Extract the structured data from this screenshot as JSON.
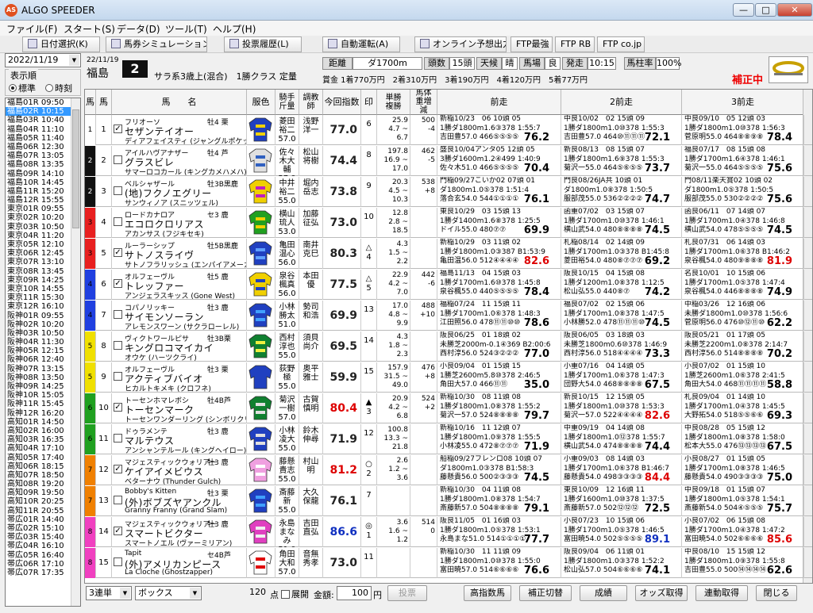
{
  "app": {
    "title": "ALGO SPEEDER",
    "icon": "AS"
  },
  "menu": [
    "ファイル(F)",
    "スタート(S)",
    "データ(D)",
    "ツール(T)",
    "ヘルプ(H)"
  ],
  "toolbar": [
    "日付選択(K)",
    "馬券シミュレーション(B)",
    "投票履歴(L)",
    "自動運転(A)",
    "オンライン予想出力",
    "FTP最強",
    "FTP RB",
    "FTP co.jp"
  ],
  "left": {
    "date": "2022/11/19",
    "order_label": "表示順",
    "radio_std": "標準",
    "radio_time": "時刻",
    "races": [
      "福島01R 09:50",
      "福島02R 10:15",
      "福島03R 10:40",
      "福島04R 11:10",
      "福島05R 11:40",
      "福島06R 12:30",
      "福島07R 13:05",
      "福島08R 13:35",
      "福島09R 14:10",
      "福島10R 14:45",
      "福島11R 15:20",
      "福島12R 15:55",
      "東京01R 09:55",
      "東京02R 10:20",
      "東京03R 10:50",
      "東京04R 11:20",
      "東京05R 12:10",
      "東京06R 12:45",
      "東京07R 13:10",
      "東京08R 13:45",
      "東京09R 14:25",
      "東京10R 14:55",
      "東京11R 15:30",
      "東京12R 16:10",
      "阪神01R 09:55",
      "阪神02R 10:20",
      "阪神03R 10:50",
      "阪神04R 11:30",
      "阪神05R 12:15",
      "阪神06R 12:40",
      "阪神07R 13:15",
      "阪神08R 13:50",
      "阪神09R 14:25",
      "阪神10R 15:05",
      "阪神11R 15:45",
      "阪神12R 16:20",
      "高知01R 14:50",
      "高知02R 16:00",
      "高知03R 16:35",
      "高知04R 17:10",
      "高知05R 17:40",
      "高知06R 18:15",
      "高知07R 18:50",
      "高知08R 19:20",
      "高知09R 19:50",
      "高知10R 20:25",
      "高知11R 20:55",
      "帯広01R 14:40",
      "帯広02R 15:10",
      "帯広03R 15:40",
      "帯広04R 16:10",
      "帯広05R 16:40",
      "帯広06R 17:10",
      "帯広07R 17:35"
    ],
    "selected": 1
  },
  "race": {
    "date": "22/11/19",
    "venue": "福島",
    "no": "2",
    "class": "サラ系3歳上(混合)　1勝クラス 定量",
    "lbl_dist": "距離",
    "dist": "ダ1700m",
    "lbl_heads": "頭数",
    "heads": "15頭",
    "lbl_weather": "天候",
    "weather": "晴",
    "lbl_track": "馬場",
    "track": "良",
    "lbl_start": "発走",
    "start": "10:15",
    "lbl_umabashira": "馬柱率",
    "umabashira": "100%",
    "prizes": "賞金 1着770万円　2着310万円　3着190万円　4着120万円　5着77万円",
    "status": "補正中"
  },
  "headers": {
    "waku": "馬",
    "uma": "馬",
    "name": "馬　　名",
    "silk": "服色",
    "jockey": "騎手斤量",
    "trainer": "調教師",
    "index": "今回指数",
    "mark": "印",
    "odds": "単勝複勝",
    "weight": "馬体重増減",
    "prev1": "前走",
    "prev2": "2前走",
    "prev3": "3前走"
  },
  "horses": [
    {
      "waku": "1",
      "uma": "1",
      "chk": true,
      "sire": "フリオーソ",
      "name": "セザンテイオー",
      "dam": "ディアフェイスティ (ジャングルポケット)",
      "sa": "牡4 栗",
      "jockey": "菱田裕二",
      "kg": "57.0",
      "trainer": "浅野洋一",
      "index": "77.0",
      "ic": "",
      "mark": "",
      "rank": "6",
      "o1": "25.9",
      "o2": "4.7 ~ 6.7",
      "w": "500",
      "wd": "-4",
      "p1": [
        "新稲10/23　06 10頭 05",
        "1勝ダ1800m1.6③378 1:55:7",
        "吉田豊57.0 466⑤⑤⑤⑤",
        "76.2"
      ],
      "p2": [
        "中良10/02　02 15頭 09",
        "1勝ダ1800m1.0⑩378 1:55:3",
        "吉田豊57.0 464⑩⑪⑪⑪",
        "72.1"
      ],
      "p3": [
        "中良09/10　05 12頭 03",
        "1勝ダ1800m1.0⑩378 1:56:3",
        "菅原明55.0 464⑧⑧⑨⑧",
        "78.4"
      ]
    },
    {
      "waku": "2",
      "uma": "2",
      "chk": false,
      "sire": "アイルハヴアナザー",
      "name": "グラスビレ",
      "dam": "サマーロコカール (キングカメハメハ)",
      "sa": "牡4 芦",
      "jockey": "佐々木大輔",
      "kg": "57.0",
      "trainer": "松山将樹",
      "index": "74.4",
      "ic": "",
      "mark": "",
      "rank": "8",
      "o1": "197.8",
      "o2": "16.9 ~ 17.0",
      "w": "462",
      "wd": "-5",
      "p1": [
        "盛良10/04アンタ05 12頭 05",
        "3勝ダ1600m1.2④499 1:40:9",
        "佐々木51.0 466⑤⑤⑤⑤",
        "70.4"
      ],
      "p2": [
        "新良08/13　08 15頭 07",
        "1勝ダ1800m1.6⑨378 1:55:3",
        "菊沢一55.0 464⑤⑥⑤⑤",
        "73.7"
      ],
      "p3": [
        "福良07/17　08 15頭 08",
        "1勝ダ1700m1.6④378 1:46:1",
        "菊沢一55.0 464⑤⑤⑤⑤",
        "75.6"
      ]
    },
    {
      "waku": "2",
      "uma": "3",
      "chk": false,
      "sire": "ベルシャザール",
      "name": "(地)フクノエグリー",
      "dam": "サンウィノア (スニッツェル)",
      "sa": "牡3B黒鹿",
      "jockey": "中井裕二",
      "kg": "55.0",
      "trainer": "堀内岳志",
      "index": "73.8",
      "ic": "",
      "mark": "",
      "rank": "9",
      "o1": "20.3",
      "o2": "4.5 ~ 10.3",
      "w": "538",
      "wd": "+8",
      "p1": [
        "門稲09/27こいか02 07頭 01",
        "ダ1800m1.0⑤378 1:51:4",
        "落合玄54.0 544①①①①",
        "76.1"
      ],
      "p2": [
        "門良08/26JA共 10頭 01",
        "ダ1800m1.0⑧378 1:50:5",
        "服部茂55.0 536②②②②",
        "74.7"
      ],
      "p3": [
        "門08/11楽天賞02 10頭 02",
        "ダ1800m1.0⑤378 1:50:5",
        "服部茂55.0 530②②②②",
        "75.6"
      ]
    },
    {
      "waku": "3",
      "uma": "4",
      "chk": false,
      "sire": "ロードカナロア",
      "name": "エコロクロリアス",
      "dam": "アカンサス (フジキセキ)",
      "sa": "セ3 鹿",
      "jockey": "横山琉人",
      "kg": "53.0",
      "trainer": "加藤征弘",
      "index": "73.0",
      "ic": "",
      "mark": "",
      "rank": "10",
      "o1": "12.8",
      "o2": "2.8 ~ 18.5",
      "w": "",
      "wd": "",
      "p1": [
        "東良10/29　03 15頭 13",
        "1勝ダ1400m1.6⑧378 1:25:5",
        "ドイル55.0 480⑦⑦",
        "69.9"
      ],
      "p2": [
        "函重07/02　03 15頭 07",
        "1勝ダ1700m1.0⑩378 1:46:1",
        "横山武54.0 480⑧⑧⑧⑧",
        "74.5"
      ],
      "p3": [
        "函良06/11　07 14頭 07",
        "1勝ダ1700m1.0④378 1:46:8",
        "横山武54.0 478⑤⑤⑤⑤",
        "74.5"
      ]
    },
    {
      "waku": "3",
      "uma": "5",
      "chk": true,
      "sire": "ルーラーシップ",
      "name": "サトノスライヴ",
      "dam": "サトノフラリッシュ (エンパイアメーカー)",
      "sa": "牡5B黒鹿",
      "jockey": "亀田温心",
      "kg": "56.0",
      "trainer": "南井克巳",
      "index": "80.3",
      "ic": "",
      "mark": "△",
      "rank": "4",
      "o1": "4.3",
      "o2": "1.5 ~ 2.2",
      "w": "",
      "wd": "",
      "p1": [
        "新稲10/29　03 11頭 02",
        "1勝ダ1800m1.0③387 B1:53:9",
        "亀田温56.0 512④④④④",
        "82.6"
      ],
      "p2": [
        "札稲08/14　02 14頭 09",
        "1勝ダ1700m1.0③378 B1:45:8",
        "菱田裕54.0 480⑧⑦⑦⑦",
        "69.2"
      ],
      "p3": [
        "札良07/31　06 14頭 03",
        "1勝ダ1700m1.0⑥378 B1:46:2",
        "泉谷楓54.0 480⑨⑧⑧⑧",
        "81.9"
      ]
    },
    {
      "waku": "4",
      "uma": "6",
      "chk": true,
      "sire": "オルフェーヴル",
      "name": "トレッファー",
      "dam": "アンジェラスキッス (Gone West)",
      "sa": "牡5 鹿",
      "jockey": "泉谷楓真",
      "kg": "56.0",
      "trainer": "本田優",
      "index": "77.5",
      "ic": "",
      "mark": "△",
      "rank": "5",
      "o1": "22.9",
      "o2": "4.2 ~ 7.0",
      "w": "442",
      "wd": "-6",
      "p1": [
        "福島11/13　04 15頭 03",
        "1勝ダ1700m1.6⑩378 1:45:8",
        "泉谷楓55.0 440⑤⑤⑤⑤",
        "78.4"
      ],
      "p2": [
        "阪良10/15　04 15頭 08",
        "1勝ダ1200m1.0⑧378 1:12:5",
        "松山弘55.0 440⑧⑦",
        "74.2"
      ],
      "p3": [
        "名良10/01　10 15頭 06",
        "1勝ダ1700m1.0⑤378 1:47:4",
        "泉谷楓54.0 446⑧⑧⑧⑧",
        "74.9"
      ]
    },
    {
      "waku": "4",
      "uma": "7",
      "chk": false,
      "sire": "コパノリッキー",
      "name": "サイモンソーラン",
      "dam": "アレモンスワーン (サクラローレル)",
      "sa": "牡3 鹿",
      "jockey": "小林勝太",
      "kg": "51.0",
      "trainer": "勢司和浩",
      "index": "69.9",
      "ic": "",
      "mark": "",
      "rank": "13",
      "o1": "17.0",
      "o2": "4.8 ~ 9.9",
      "w": "488",
      "wd": "+10",
      "p1": [
        "福稲07/24　11 15頭 11",
        "1勝ダ1700m1.0⑥378 1:48:3",
        "江田照56.0 478⑪⑪⑩⑩",
        "78.6"
      ],
      "p2": [
        "福良07/02　02 15頭 06",
        "1勝ダ1700m1.0⑧378 1:47:5",
        "小林勝52.0 478⑪⑪⑪⑩",
        "74.5"
      ],
      "p3": [
        "中稲03/26　12 16頭 06",
        "未勝ダ1800m1.0⑩378 1:56:6",
        "菅原明56.0 476⑩⑫⑪⑩",
        "62.2"
      ]
    },
    {
      "waku": "5",
      "uma": "8",
      "chk": false,
      "sire": "ヴィクトワールピサ",
      "name": "キングロコマイカイ",
      "dam": "オウケ (ハーツクライ)",
      "sa": "牡3B栗",
      "jockey": "西村淳也",
      "kg": "55.0",
      "trainer": "須貝尚介",
      "index": "69.5",
      "ic": "",
      "mark": "",
      "rank": "14",
      "o1": "4.3",
      "o2": "1.8 ~ 2.3",
      "w": "",
      "wd": "",
      "p1": [
        "阪良06/25　01 18頭 02",
        "未勝芝2000m-0.1④369 B2:00:6",
        "西村淳56.0 524③②②②",
        "77.0"
      ],
      "p2": [
        "阪良06/05　03 18頭 03",
        "未勝芝1800m0.6⑩378 1:46:9",
        "西村淳56.0 518④④④④",
        "73.3"
      ],
      "p3": [
        "阪良05/21　01 17頭 05",
        "未勝芝2200m1.0⑧378 2:14:7",
        "西村淳56.0 514⑧⑧⑧⑧",
        "70.2"
      ]
    },
    {
      "waku": "5",
      "uma": "9",
      "chk": false,
      "sire": "オルフェーヴル",
      "name": "アクティブバイオ",
      "dam": "ヒカルトキメキ (クロフネ)",
      "sa": "牡3 栗",
      "jockey": "荻野極",
      "kg": "55.0",
      "trainer": "奥平雅士",
      "index": "59.9",
      "ic": "",
      "mark": "",
      "rank": "15",
      "o1": "157.9",
      "o2": "31.5 ~ 49.0",
      "w": "476",
      "wd": "+8",
      "p1": [
        "小良09/04　01 15頭 15",
        "1勝芝2600m5.8⑩378 2:46:5",
        "角田大57.0 466⑪⑪",
        "35.0"
      ],
      "p2": [
        "小重07/16　04 14頭 05",
        "1勝ダ1700m1.0⑥378 1:47:3",
        "団野大54.0 468⑧⑧⑧⑧",
        "67.5"
      ],
      "p3": [
        "小良07/02　01 15頭 10",
        "1勝芝2600m1.0⑥378 2:41:5",
        "角田大54.0 468⑪⑪⑪⑪",
        "58.8"
      ]
    },
    {
      "waku": "6",
      "uma": "10",
      "chk": true,
      "sire": "トーセンホマレボシ",
      "name": "トーセンマーク",
      "dam": "トーセンワンダーリング (シンボリクリスエス)",
      "sa": "牡4B芦",
      "jockey": "菊沢一樹",
      "kg": "57.0",
      "trainer": "古賀慎明",
      "index": "80.4",
      "ic": "red",
      "mark": "▲",
      "rank": "3",
      "o1": "20.9",
      "o2": "4.2 ~ 6.8",
      "w": "524",
      "wd": "+2",
      "p1": [
        "新稲10/30　08 11頭 08",
        "1勝ダ1800m1.0⑧378 1:55:2",
        "菊沢一57.0 524⑧⑧⑧⑧",
        "79.7"
      ],
      "p2": [
        "新良10/15　12 15頭 05",
        "1勝ダ1800m1.0⑩378 1:53:3",
        "菊沢一57.0 522④④④④",
        "82.6"
      ],
      "p3": [
        "札良09/04　01 14頭 10",
        "1勝ダ1700m1.0④378 1:45:5",
        "大野拓54.0 518⑤⑤⑥⑥",
        "69.3"
      ]
    },
    {
      "waku": "6",
      "uma": "11",
      "chk": false,
      "sire": "ドゥラメンテ",
      "name": "マルテウス",
      "dam": "アンシャンテルール (キングヘイロー)",
      "sa": "牡3 鹿",
      "jockey": "小林凌大",
      "kg": "55.0",
      "trainer": "鈴木伸尋",
      "index": "71.9",
      "ic": "",
      "mark": "",
      "rank": "12",
      "o1": "100.8",
      "o2": "13.3 ~ 21.8",
      "w": "",
      "wd": "",
      "p1": [
        "新稲10/16　11 12頭 07",
        "1勝ダ1800m1.0⑨378 1:55:5",
        "小林凌55.0 472⑧⑦⑦⑦",
        "71.9"
      ],
      "p2": [
        "中重09/19　04 14頭 08",
        "1勝ダ1800m1.0⑫378 1:55:7",
        "横山武54.0 474⑧⑧⑧⑧",
        "74.4"
      ],
      "p3": [
        "中良08/28　05 15頭 12",
        "1勝ダ1800m1.0⑧378 1:58:0",
        "松本大55.0 476⑬⑬⑬⑬",
        "67.5"
      ]
    },
    {
      "waku": "7",
      "uma": "12",
      "chk": true,
      "sire": "マジェスティックウォリアー",
      "name": "ケイアイメビウス",
      "dam": "ベターナウ (Thunder Gulch)",
      "sa": "牡3 鹿",
      "jockey": "藤懸貴志",
      "kg": "55.0",
      "trainer": "村山明",
      "index": "81.2",
      "ic": "red",
      "mark": "○",
      "rank": "2",
      "o1": "2.6",
      "o2": "1.2 ~ 3.6",
      "w": "",
      "wd": "",
      "p1": [
        "船稲09/27フレンロ08 10頭 07",
        "ダ1800m1.0③378 B1:58:3",
        "藤懸貴56.0 500②③③③",
        "74.5"
      ],
      "p2": [
        "小重09/03　08 14頭 03",
        "1勝ダ1700m1.0⑥378 B1:46:7",
        "藤懸貴54.0 498③③③③",
        "84.4"
      ],
      "p3": [
        "小良08/27　01 15頭 05",
        "1勝ダ1700m1.0⑧378 1:46:5",
        "藤懸貴54.0 490③③③③",
        "75.0"
      ]
    },
    {
      "waku": "7",
      "uma": "13",
      "chk": false,
      "sire": "Bobby's Kitten",
      "name": "(外)ボブズヤアンクル",
      "dam": "Granny Franny (Grand Slam)",
      "sa": "牡3 栗",
      "jockey": "斎藤新",
      "kg": "55.0",
      "trainer": "大久保龍",
      "index": "76.1",
      "ic": "",
      "mark": "",
      "rank": "7",
      "o1": "",
      "o2": "",
      "w": "",
      "wd": "",
      "p1": [
        "新稲10/30　04 11頭 08",
        "1勝ダ1800m1.0⑧378 1:54:7",
        "斎藤新57.0 504⑧⑧⑧⑧",
        "79.1"
      ],
      "p2": [
        "東良10/09　12 16頭 11",
        "1勝ダ1600m1.0⑩378 1:37:5",
        "斎藤新57.0 502⑫⑫⑫",
        "72.5"
      ],
      "p3": [
        "中良09/18　01 15頭 07",
        "1勝ダ1800m1.0⑤378 1:54:1",
        "斎藤新54.0 504④⑤⑤⑤",
        "75.7"
      ]
    },
    {
      "waku": "8",
      "uma": "14",
      "chk": true,
      "sire": "マジェスティックウォリアー",
      "name": "スマートビクター",
      "dam": "スマートノエル (ヴァーミリアン)",
      "sa": "牡3 鹿",
      "jockey": "永島まなみ",
      "kg": "51.0",
      "trainer": "吉田直弘",
      "index": "86.6",
      "ic": "blue",
      "mark": "◎",
      "rank": "1",
      "o1": "3.6",
      "o2": "1.6 ~ 1.2",
      "w": "514",
      "wd": "0",
      "p1": [
        "阪良11/05　01 16頭 03",
        "1勝ダ1800m1.0⑤378 1:53:1",
        "永島まな51.0 514①①①①",
        "77.7"
      ],
      "p2": [
        "小良07/23　10 15頭 06",
        "1勝ダ1700m1.0⑤378 1:46:5",
        "富田暁54.0 502⑤⑤⑤⑤",
        "89.1"
      ],
      "p3": [
        "小良07/02　06 15頭 08",
        "1勝ダ1700m1.0④378 1:47:2",
        "富田暁54.0 502⑥⑥⑥⑥",
        "85.6"
      ]
    },
    {
      "waku": "8",
      "uma": "15",
      "chk": false,
      "sire": "Tapit",
      "name": "(外)アメリカンピース",
      "dam": "La Cloche (Ghostzapper)",
      "sa": "セ4B芦",
      "jockey": "角田大和",
      "kg": "57.0",
      "trainer": "音無秀孝",
      "index": "73.0",
      "ic": "",
      "mark": "",
      "rank": "11",
      "o1": "",
      "o2": "",
      "w": "",
      "wd": "",
      "p1": [
        "新稲10/30　11 11頭 09",
        "1勝ダ1800m1.0⑩378 1:55:0",
        "富田暁57.0 514⑥⑥⑥⑥",
        "76.6"
      ],
      "p2": [
        "阪良09/04　06 11頭 01",
        "1勝ダ1800m1.0③378 1:52:2",
        "松山弘57.0 504⑥⑥⑥⑥",
        "74.1"
      ],
      "p3": [
        "中良08/10　15 15頭 12",
        "1勝ダ1800m1.0⑨378 1:55:8",
        "吉田豊55.0 500⑭⑭⑭⑭",
        "62.6"
      ]
    }
  ],
  "waku_colors": [
    "#ffffff",
    "#111111",
    "#e82020",
    "#2040e0",
    "#f0e000",
    "#20a020",
    "#f08000",
    "#f040c0"
  ],
  "bottom": {
    "bet_type": "3連単",
    "mode": "ボックス",
    "points": "120",
    "pts_unit": "点",
    "expand": "展開",
    "amount_lbl": "金額:",
    "amount": "100",
    "yen": "円",
    "btn_vote": "投票",
    "btn_high": "高指数馬",
    "btn_switch": "補正切替",
    "btn_print": "成績",
    "btn_odds": "オッズ取得",
    "btn_link": "連動取得",
    "btn_close": "閉じる"
  }
}
